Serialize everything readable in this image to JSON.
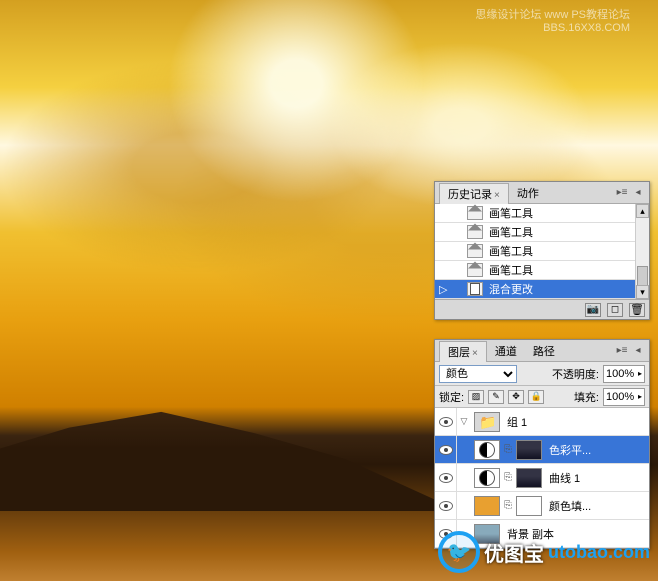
{
  "watermark_top": {
    "line1": "思缘设计论坛  www  PS教程论坛",
    "line2": "BBS.16XX8.COM"
  },
  "watermark_bottom": {
    "brand": "优图宝",
    "domain": "utobao.com"
  },
  "history_panel": {
    "tabs": {
      "history": "历史记录",
      "actions": "动作"
    },
    "items": [
      {
        "label": "画笔工具",
        "type": "brush"
      },
      {
        "label": "画笔工具",
        "type": "brush"
      },
      {
        "label": "画笔工具",
        "type": "brush"
      },
      {
        "label": "画笔工具",
        "type": "brush"
      },
      {
        "label": "混合更改",
        "type": "blend",
        "selected": true
      }
    ]
  },
  "layers_panel": {
    "tabs": {
      "layers": "图层",
      "channels": "通道",
      "paths": "路径"
    },
    "blend_mode": "颜色",
    "opacity_label": "不透明度:",
    "opacity_value": "100%",
    "lock_label": "锁定:",
    "fill_label": "填充:",
    "fill_value": "100%",
    "layers": [
      {
        "name": "组 1",
        "type": "group"
      },
      {
        "name": "色彩平...",
        "type": "adjustment",
        "selected": true
      },
      {
        "name": "曲线 1",
        "type": "adjustment"
      },
      {
        "name": "颜色填...",
        "type": "solid"
      },
      {
        "name": "背景 副本",
        "type": "image"
      }
    ]
  }
}
